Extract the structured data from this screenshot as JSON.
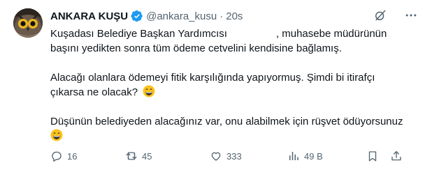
{
  "tweet": {
    "author": {
      "name": "ANKARA KUŞU",
      "handle": "@ankara_kusu",
      "separator": "·",
      "time": "20s"
    },
    "paragraphs": [
      {
        "line1_before": "Kuşadası Belediye Başkan Yardımcısı",
        "line1_after": ", muhasebe müdürünün",
        "line2": "başını yedikten sonra tüm ödeme cetvelini kendisine bağlamış."
      },
      {
        "line1": "Alacağı olanlara ödemeyi fitik karşılığında yapıyormuş. Şimdi bi itirafçı",
        "line2": "çıkarsa ne olacak?"
      },
      {
        "line1": "Düşünün belediyeden alacağınız var, onu alabilmek için rüşvet ödüyorsunuz"
      }
    ],
    "metrics": {
      "replies": "16",
      "retweets": "45",
      "likes": "333",
      "views": "49 B"
    },
    "icons": {
      "grok": "grok-icon",
      "more": "more-icon",
      "emoji": "grinning-face-emoji",
      "verified": "verified-badge-icon"
    },
    "colors": {
      "verified_blue": "#1d9bf0",
      "secondary_text": "#536471",
      "emoji_yellow": "#fcc21b"
    }
  }
}
